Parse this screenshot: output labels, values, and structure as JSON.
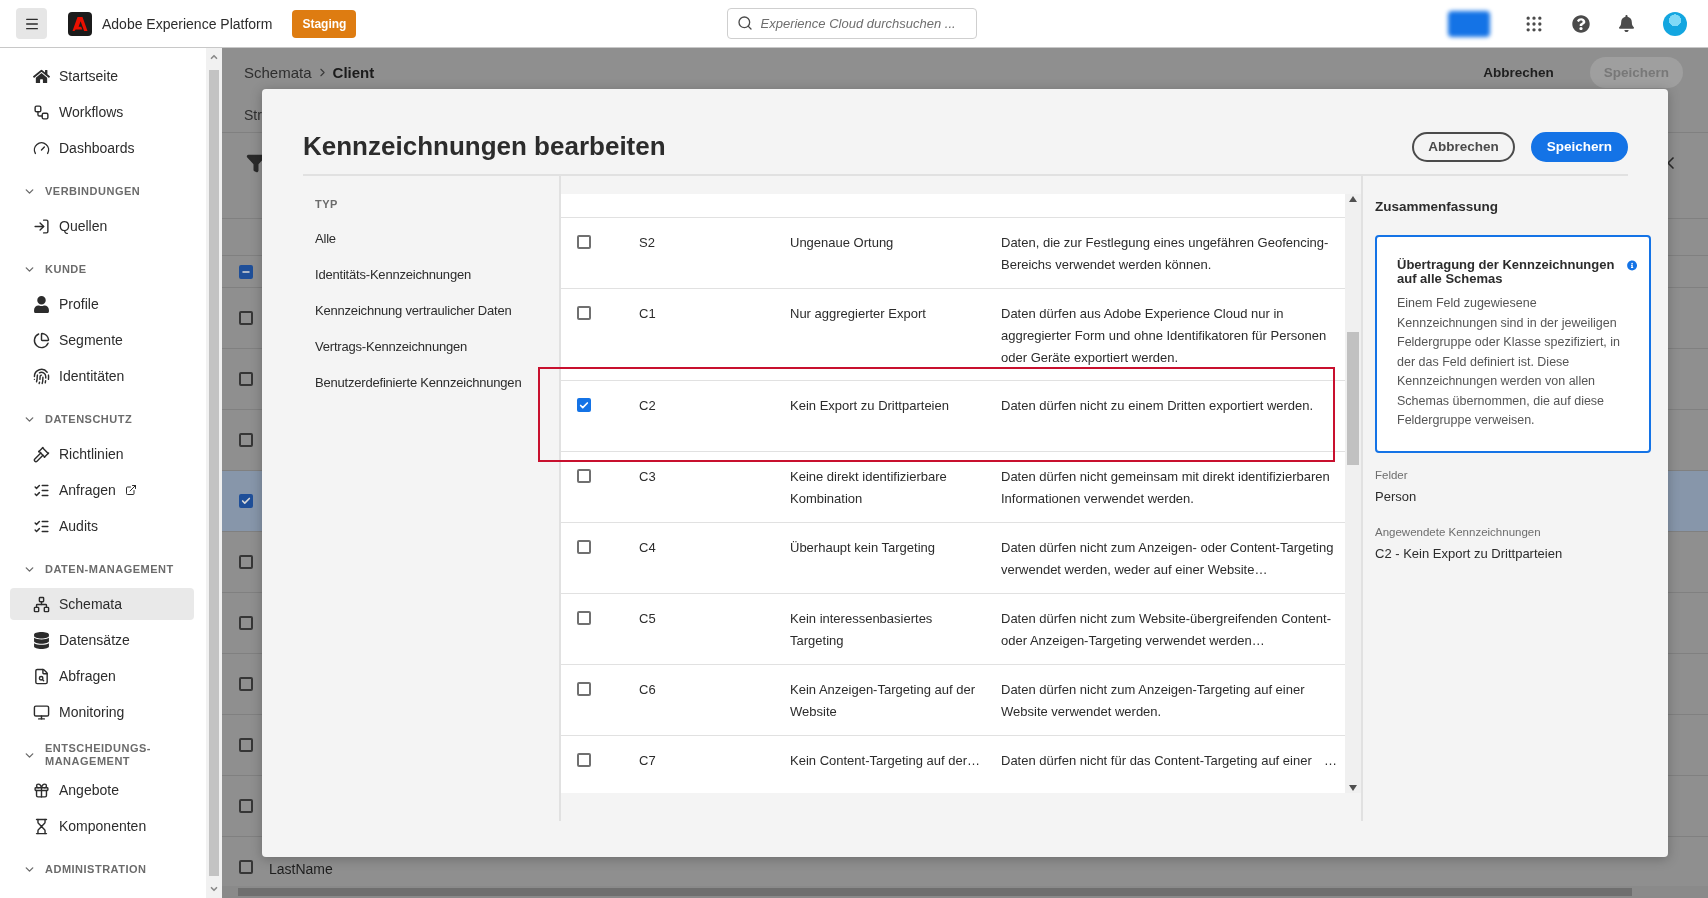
{
  "topbar": {
    "app_name": "Adobe Experience Platform",
    "environment": "Staging",
    "search": {
      "placeholder": "Experience Cloud durchsuchen ..."
    }
  },
  "sidebar": {
    "items": [
      {
        "kind": "link",
        "label": "Startseite",
        "selected": false,
        "external": false
      },
      {
        "kind": "link",
        "label": "Workflows",
        "selected": false,
        "external": false
      },
      {
        "kind": "link",
        "label": "Dashboards",
        "selected": false,
        "external": false
      },
      {
        "kind": "section",
        "label": "VERBINDUNGEN",
        "expanded": true,
        "children": [
          {
            "kind": "link",
            "label": "Quellen",
            "selected": false,
            "external": false
          }
        ]
      },
      {
        "kind": "section",
        "label": "KUNDE",
        "expanded": true,
        "children": [
          {
            "kind": "link",
            "label": "Profile",
            "selected": false,
            "external": false
          },
          {
            "kind": "link",
            "label": "Segmente",
            "selected": false,
            "external": false
          },
          {
            "kind": "link",
            "label": "Identitäten",
            "selected": false,
            "external": false
          }
        ]
      },
      {
        "kind": "section",
        "label": "DATENSCHUTZ",
        "expanded": true,
        "children": [
          {
            "kind": "link",
            "label": "Richtlinien",
            "selected": false,
            "external": false
          },
          {
            "kind": "link",
            "label": "Anfragen",
            "selected": false,
            "external": true
          },
          {
            "kind": "link",
            "label": "Audits",
            "selected": false,
            "external": false
          }
        ]
      },
      {
        "kind": "section",
        "label": "DATEN-MANAGEMENT",
        "expanded": true,
        "children": [
          {
            "kind": "link",
            "label": "Schemata",
            "selected": true,
            "external": false
          },
          {
            "kind": "link",
            "label": "Datensätze",
            "selected": false,
            "external": false
          },
          {
            "kind": "link",
            "label": "Abfragen",
            "selected": false,
            "external": false
          },
          {
            "kind": "link",
            "label": "Monitoring",
            "selected": false,
            "external": false
          }
        ]
      },
      {
        "kind": "section",
        "label": "ENTSCHEIDUNGS-MANAGEMENT",
        "expanded": true,
        "children": [
          {
            "kind": "link",
            "label": "Angebote",
            "selected": false,
            "external": false
          },
          {
            "kind": "link",
            "label": "Komponenten",
            "selected": false,
            "external": false
          }
        ]
      },
      {
        "kind": "section",
        "label": "ADMINISTRATION",
        "expanded": true
      }
    ]
  },
  "page": {
    "breadcrumb": [
      "Schemata",
      "Client"
    ],
    "tab_fragment": "Str",
    "actions": [
      {
        "label": "Abbrechen",
        "kind": "text",
        "disabled": false
      },
      {
        "label": "Speichern",
        "kind": "filled",
        "disabled": true
      }
    ],
    "header_checkbox": {
      "indeterminate": true
    },
    "rows": [
      {
        "checked": false
      },
      {
        "checked": false
      },
      {
        "checked": false
      },
      {
        "checked": true
      },
      {
        "checked": false
      },
      {
        "checked": false
      },
      {
        "checked": false
      },
      {
        "checked": false
      },
      {
        "checked": false
      },
      {
        "checked": false,
        "field": "LastName"
      }
    ]
  },
  "dialog": {
    "title": "Kennzeichnungen bearbeiten",
    "buttons": [
      {
        "label": "Abbrechen",
        "kind": "secondary"
      },
      {
        "label": "Speichern",
        "kind": "primary"
      }
    ],
    "filter": {
      "heading": "TYP",
      "items": [
        "Alle",
        "Identitäts-Kennzeichnungen",
        "Kennzeichnung vertraulicher Daten",
        "Vertrags-Kennzeichnungen",
        "Benutzerdefinierte Kennzeichnungen"
      ]
    },
    "labels": [
      {
        "checked": false,
        "highlighted": false,
        "code": "S2",
        "name": "Ungenaue Ortung",
        "description": "Daten, die zur Festlegung eines ungefähren Geofencing-Bereichs verwendet werden können."
      },
      {
        "checked": false,
        "highlighted": false,
        "code": "C1",
        "name": "Nur aggregierter Export",
        "description": "Daten dürfen aus Adobe Experience Cloud nur in aggregierter Form und ohne Identifikatoren für Personen oder Geräte exportiert werden."
      },
      {
        "checked": true,
        "highlighted": true,
        "code": "C2",
        "name": "Kein Export zu Drittparteien",
        "description": "Daten dürfen nicht zu einem Dritten exportiert werden."
      },
      {
        "checked": false,
        "highlighted": false,
        "code": "C3",
        "name": "Keine direkt identifizierbare Kombination",
        "description": "Daten dürfen nicht gemeinsam mit direkt identifizierbaren Informationen verwendet werden."
      },
      {
        "checked": false,
        "highlighted": false,
        "code": "C4",
        "name": "Überhaupt kein Targeting",
        "description": "Daten dürfen nicht zum Anzeigen- oder Content-Targeting verwendet werden, weder auf einer Website…"
      },
      {
        "checked": false,
        "highlighted": false,
        "code": "C5",
        "name": "Kein interessenbasiertes Targeting",
        "description": "Daten dürfen nicht zum Website-übergreifenden Content- oder Anzeigen-Targeting verwendet werden…"
      },
      {
        "checked": false,
        "highlighted": false,
        "code": "C6",
        "name": "Kein Anzeigen-Targeting auf der Website",
        "description": "Daten dürfen nicht zum Anzeigen-Targeting auf einer Website verwendet werden."
      },
      {
        "checked": false,
        "highlighted": false,
        "code": "C7",
        "name": "Kein Content-Targeting auf der…",
        "description": "Daten dürfen nicht für das Content-Targeting auf einer",
        "overflow_mark": "…"
      }
    ],
    "summary": {
      "title": "Zusammenfassung",
      "card_title": "Übertragung der Kennzeichnungen auf alle Schemas",
      "card_body": "Einem Feld zugewiesene Kennzeichnungen sind in der jeweiligen Feldergruppe oder Klasse spezifiziert, in der das Feld definiert ist. Diese Kennzeichnungen werden von allen Schemas übernommen, die auf diese Feldergruppe verweisen.",
      "fields_label": "Felder",
      "fields_value": "Person",
      "applied_label": "Angewendete Kennzeichnungen",
      "applied_value": "C2 - Kein Export zu Drittparteien"
    }
  }
}
